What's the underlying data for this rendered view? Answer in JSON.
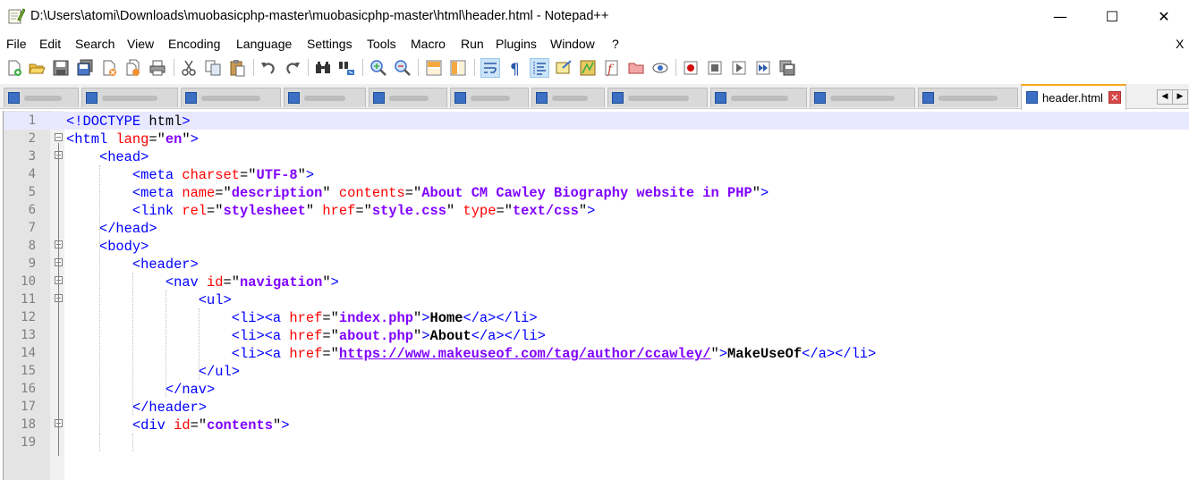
{
  "window": {
    "title": "D:\\Users\\atomi\\Downloads\\muobasicphp-master\\muobasicphp-master\\html\\header.html - Notepad++",
    "minimize_glyph": "—",
    "maximize_glyph": "☐",
    "close_glyph": "✕"
  },
  "menu": [
    "File",
    "Edit",
    "Search",
    "View",
    "Encoding",
    "Language",
    "Settings",
    "Tools",
    "Macro",
    "Run",
    "Plugins",
    "Window",
    "?"
  ],
  "menu_close": "X",
  "toolbar_icons": [
    "new-file-icon",
    "open-file-icon",
    "save-icon",
    "save-all-icon",
    "close-icon",
    "close-all-icon",
    "print-icon",
    "cut-icon",
    "copy-icon",
    "paste-icon",
    "undo-icon",
    "redo-icon",
    "find-icon",
    "replace-icon",
    "zoom-in-icon",
    "zoom-out-icon",
    "sync-vertical-icon",
    "sync-horizontal-icon",
    "word-wrap-icon",
    "show-all-chars-icon",
    "indent-guide-icon",
    "udl-icon",
    "doc-map-icon",
    "function-list-icon",
    "folder-workspace-icon",
    "monitor-icon",
    "record-macro-icon",
    "stop-macro-icon",
    "play-macro-icon",
    "run-macro-multiple-icon",
    "save-macro-icon"
  ],
  "active_tab": {
    "label": "header.html",
    "close_glyph": "✕"
  },
  "tab_scroll": {
    "left": "◀",
    "right": "▶"
  },
  "colors": {
    "tag": "#0000ff",
    "attribute": "#ff0000",
    "value": "#8000ff",
    "current_line": "#e8e8ff",
    "active_tab_accent": "#f5a623"
  },
  "code_lines": [
    {
      "num": "1",
      "indent": "",
      "text": "<!DOCTYPE html>"
    },
    {
      "num": "2",
      "indent": "",
      "text": "<html lang=\"en\">"
    },
    {
      "num": "3",
      "indent": "    ",
      "text": "<head>"
    },
    {
      "num": "4",
      "indent": "        ",
      "text": "<meta charset=\"UTF-8\">"
    },
    {
      "num": "5",
      "indent": "        ",
      "text": "<meta name=\"description\" contents=\"About CM Cawley Biography website in PHP\">"
    },
    {
      "num": "6",
      "indent": "        ",
      "text": "<link rel=\"stylesheet\" href=\"style.css\" type=\"text/css\">"
    },
    {
      "num": "7",
      "indent": "    ",
      "text": "</head>"
    },
    {
      "num": "8",
      "indent": "    ",
      "text": "<body>"
    },
    {
      "num": "9",
      "indent": "        ",
      "text": "<header>"
    },
    {
      "num": "10",
      "indent": "            ",
      "text": "<nav id=\"navigation\">"
    },
    {
      "num": "11",
      "indent": "                ",
      "text": "<ul>"
    },
    {
      "num": "12",
      "indent": "                    ",
      "text": "<li><a href=\"index.php\">Home</a></li>"
    },
    {
      "num": "13",
      "indent": "                    ",
      "text": "<li><a href=\"about.php\">About</a></li>"
    },
    {
      "num": "14",
      "indent": "                    ",
      "text": "<li><a href=\"https://www.makeuseof.com/tag/author/ccawley/\">MakeUseOf</a></li>"
    },
    {
      "num": "15",
      "indent": "                ",
      "text": "</ul>"
    },
    {
      "num": "16",
      "indent": "            ",
      "text": "</nav>"
    },
    {
      "num": "17",
      "indent": "        ",
      "text": "</header>"
    },
    {
      "num": "18",
      "indent": "        ",
      "text": "<div id=\"contents\">"
    },
    {
      "num": "19",
      "indent": "",
      "text": ""
    }
  ]
}
